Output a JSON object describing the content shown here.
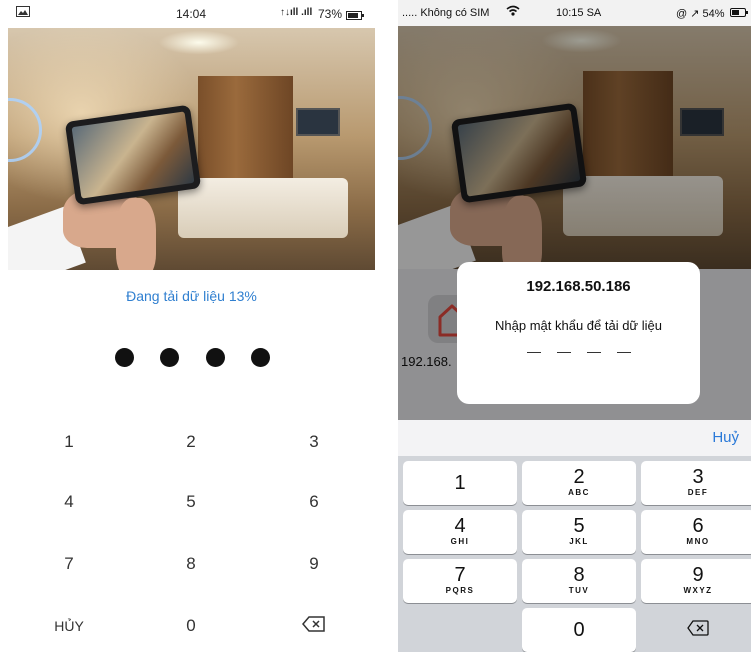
{
  "left_screen": {
    "status": {
      "time": "14:04",
      "signal": "↑↓ıll .ıll",
      "battery": "73%"
    },
    "progress_text": "Đang tải dữ liệu 13%",
    "pin_filled": 4,
    "keypad": [
      "1",
      "2",
      "3",
      "4",
      "5",
      "6",
      "7",
      "8",
      "9"
    ],
    "cancel_label": "HỦY",
    "zero_label": "0",
    "icons": {
      "backspace": "backspace-icon",
      "gallery": "image-icon"
    }
  },
  "right_screen": {
    "status": {
      "carrier": "..... Không có SIM",
      "time": "10:15 SA",
      "battery": "@ ↗ 54%"
    },
    "app_label": "192.168.",
    "dialog": {
      "title": "192.168.50.186",
      "message": "Nhập mật khẩu để tải dữ liệu"
    },
    "cancel_label": "Huỷ",
    "keys": [
      {
        "num": "1",
        "letters": ""
      },
      {
        "num": "2",
        "letters": "ABC"
      },
      {
        "num": "3",
        "letters": "DEF"
      },
      {
        "num": "4",
        "letters": "GHI"
      },
      {
        "num": "5",
        "letters": "JKL"
      },
      {
        "num": "6",
        "letters": "MNO"
      },
      {
        "num": "7",
        "letters": "PQRS"
      },
      {
        "num": "8",
        "letters": "TUV"
      },
      {
        "num": "9",
        "letters": "WXYZ"
      }
    ],
    "zero_label": "0"
  },
  "colors": {
    "accent_blue": "#2f7fd0",
    "ios_link": "#2a79d8",
    "pin_dot": "#111111"
  }
}
